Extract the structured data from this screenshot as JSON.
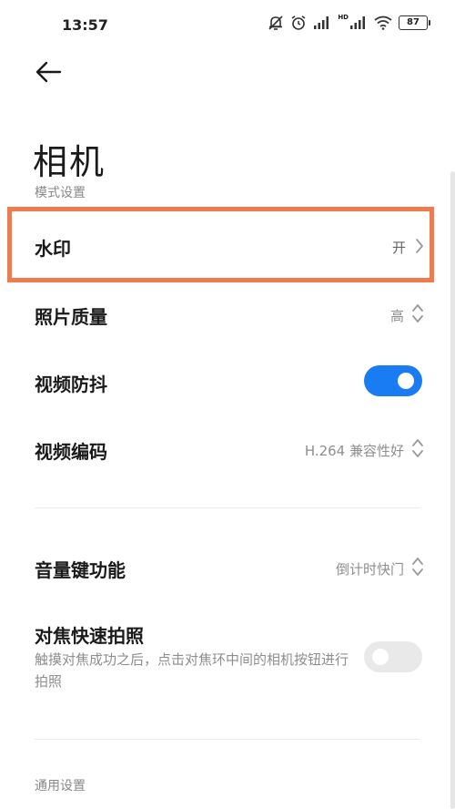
{
  "status_bar": {
    "time": "13:57",
    "battery": "87",
    "hd_label": "HD"
  },
  "header": {
    "title": "相机"
  },
  "sections": {
    "mode": {
      "title": "模式设置"
    },
    "general": {
      "title": "通用设置"
    }
  },
  "rows": {
    "watermark": {
      "label": "水印",
      "value": "开"
    },
    "photo_quality": {
      "label": "照片质量",
      "value": "高"
    },
    "stabilization": {
      "label": "视频防抖",
      "state": "on"
    },
    "video_codec": {
      "label": "视频编码",
      "value": "H.264 兼容性好"
    },
    "volume_key": {
      "label": "音量键功能",
      "value": "倒计时快门"
    },
    "focus_shoot": {
      "label": "对焦快速拍照",
      "description": "触摸对焦成功之后，点击对焦环中间的相机按钮进行拍照",
      "state": "off"
    }
  },
  "colors": {
    "accent": "#1a7cf2",
    "highlight": "#f07a4c"
  }
}
